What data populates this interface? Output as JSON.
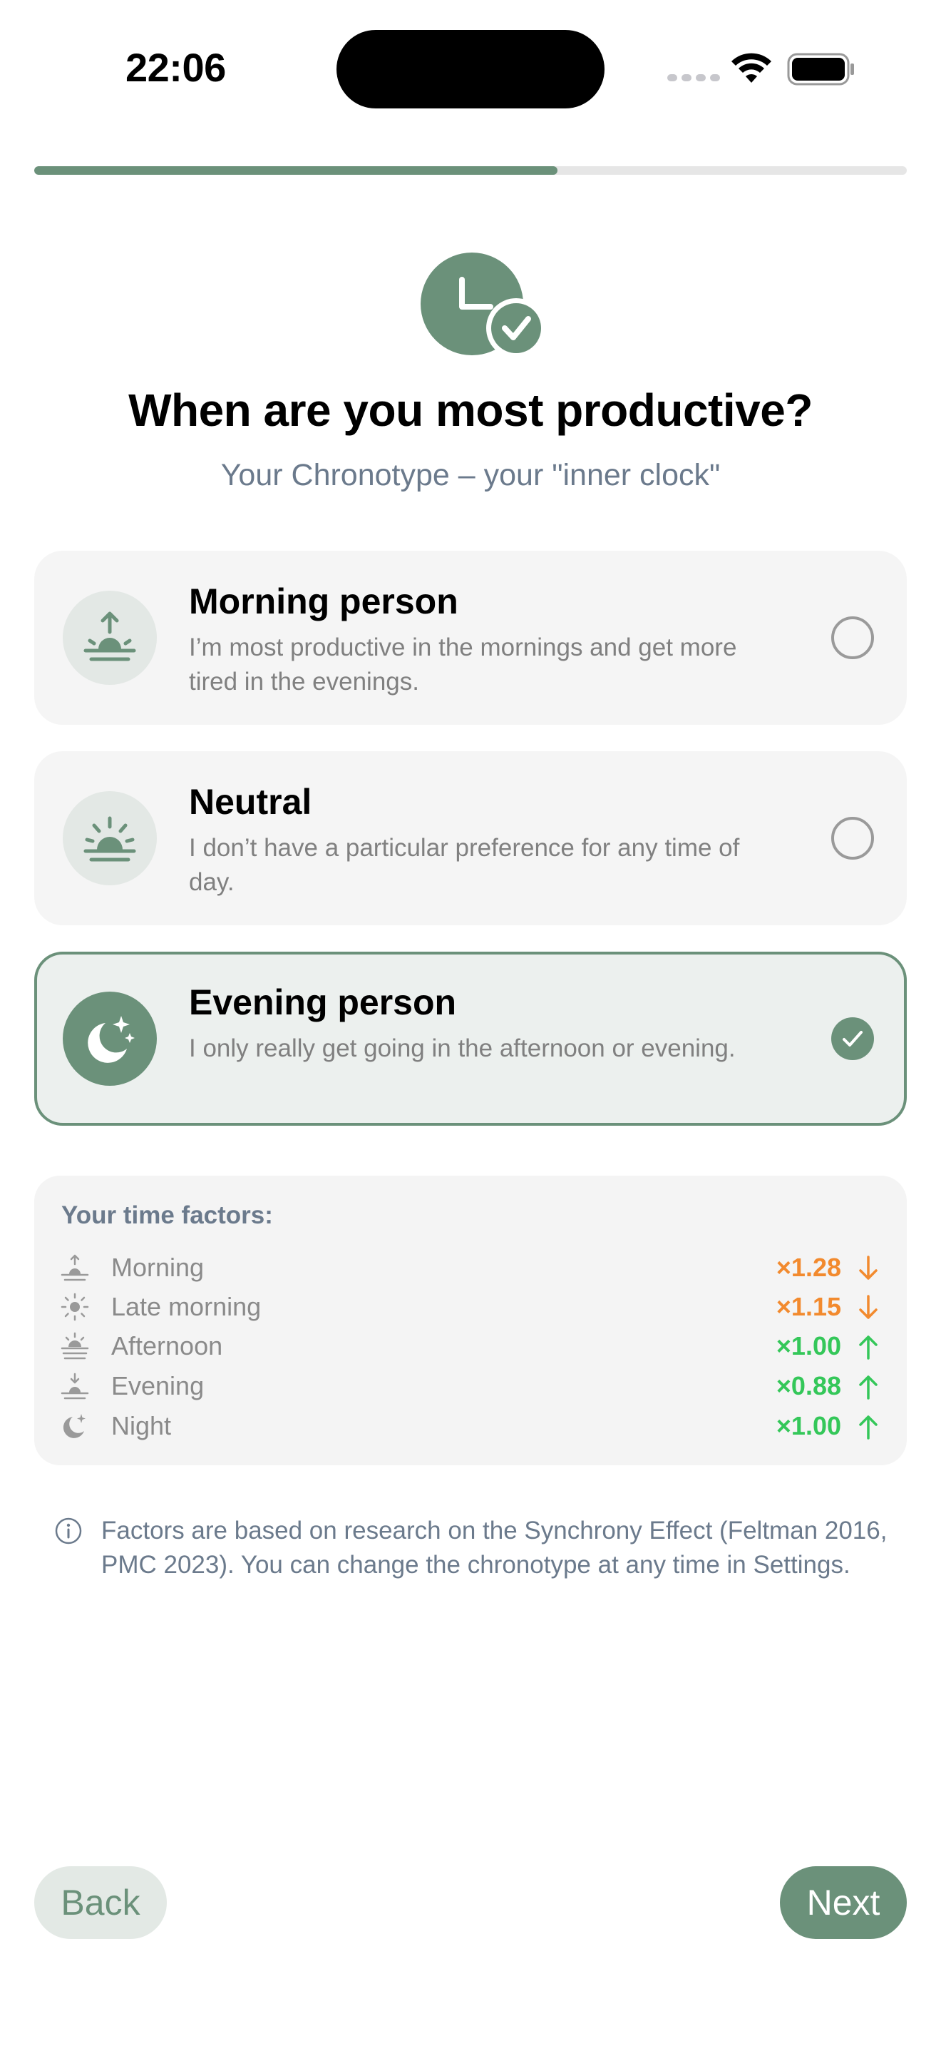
{
  "status_bar": {
    "time": "22:06"
  },
  "progress": {
    "fraction": 0.6
  },
  "header": {
    "title": "When are you most productive?",
    "subtitle": "Your Chronotype – your \"inner clock\""
  },
  "options": [
    {
      "title": "Morning person",
      "description": "I’m most productive in the mornings and get more tired in the evenings.",
      "icon": "sunrise-icon",
      "selected": false
    },
    {
      "title": "Neutral",
      "description": "I don’t have a particular preference for any time of day.",
      "icon": "sun-horizon-icon",
      "selected": false
    },
    {
      "title": "Evening person",
      "description": "I only really get going in the afternoon or evening.",
      "icon": "moon-stars-icon",
      "selected": true
    }
  ],
  "factors": {
    "title": "Your time factors:",
    "rows": [
      {
        "label": "Morning",
        "value": "×1.28",
        "trend": "down",
        "icon": "sunrise-icon"
      },
      {
        "label": "Late morning",
        "value": "×1.15",
        "trend": "down",
        "icon": "sun-icon"
      },
      {
        "label": "Afternoon",
        "value": "×1.00",
        "trend": "up",
        "icon": "sun-haze-icon"
      },
      {
        "label": "Evening",
        "value": "×0.88",
        "trend": "up",
        "icon": "sunset-icon"
      },
      {
        "label": "Night",
        "value": "×1.00",
        "trend": "up",
        "icon": "moon-stars-icon"
      }
    ]
  },
  "info": {
    "text": "Factors are based on research on the Synchrony Effect (Feltman 2016, PMC 2023). You can change the chronotype at any time in Settings."
  },
  "buttons": {
    "back": "Back",
    "next": "Next"
  },
  "colors": {
    "accent": "#6b917a",
    "down": "#f28a2e",
    "up": "#34c759",
    "muted": "#6b7a8c"
  }
}
